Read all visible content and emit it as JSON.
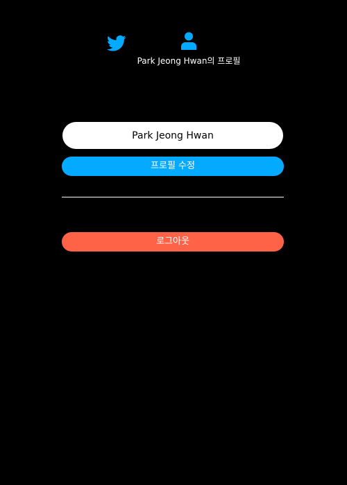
{
  "nav": {
    "home_icon": "twitter-bird-icon",
    "profile_icon": "user-icon",
    "profile_label": "Park Jeong Hwan의 프로필"
  },
  "profile_form": {
    "display_name_value": "Park Jeong Hwan",
    "update_button_label": "프로필 수정"
  },
  "logout_button_label": "로그아웃",
  "colors": {
    "background": "#000000",
    "accent": "#04AAFF",
    "logout": "#FF6347",
    "input_bg": "#FFFFFF"
  }
}
